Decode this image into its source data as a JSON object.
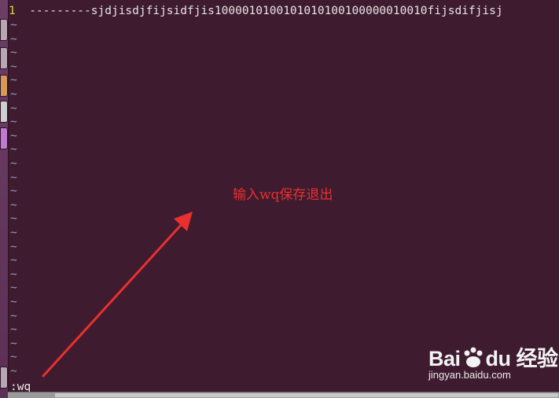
{
  "editor": {
    "line_number": "1",
    "line_text": "---------sjdjisdjfijsidfjis1000010100101010100100000010010fijsdifjisj",
    "tilde": "~",
    "command_line": ":wq"
  },
  "annotation": {
    "text": "输入wq保存退出",
    "color": "#e8302e"
  },
  "watermark": {
    "brand_left": "Bai",
    "brand_right": "du 经验",
    "url": "jingyan.baidu.com"
  },
  "colors": {
    "background": "#3f1b30",
    "line_number": "#e4d33c",
    "tilde": "#8c9eb8",
    "text": "#e6e6e6"
  }
}
